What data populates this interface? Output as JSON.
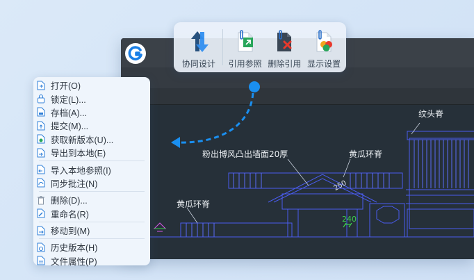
{
  "toolbar": {
    "items": [
      {
        "label": "协同设计",
        "icon": "collaborate-icon"
      },
      {
        "label": "引用参照",
        "icon": "reference-attach-icon"
      },
      {
        "label": "删除引用",
        "icon": "reference-delete-icon"
      },
      {
        "label": "显示设置",
        "icon": "display-settings-icon"
      }
    ]
  },
  "menu": {
    "groups": [
      [
        {
          "label": "打开(O)",
          "icon": "open-file-icon"
        },
        {
          "label": "锁定(L)...",
          "icon": "lock-icon"
        },
        {
          "label": "存档(A)...",
          "icon": "archive-file-icon"
        },
        {
          "label": "提交(M)...",
          "icon": "submit-file-icon"
        },
        {
          "label": "获取新版本(U)...",
          "icon": "get-latest-icon"
        },
        {
          "label": "导出到本地(E)",
          "icon": "export-file-icon"
        }
      ],
      [
        {
          "label": "导入本地参照(I)",
          "icon": "import-reference-icon"
        },
        {
          "label": "同步批注(N)",
          "icon": "sync-annotation-icon"
        }
      ],
      [
        {
          "label": "删除(D)...",
          "icon": "trash-icon"
        },
        {
          "label": "重命名(R)",
          "icon": "rename-file-icon"
        }
      ],
      [
        {
          "label": "移动到(M)",
          "icon": "move-file-icon"
        }
      ],
      [
        {
          "label": "历史版本(H)",
          "icon": "history-file-icon"
        },
        {
          "label": "文件属性(P)",
          "icon": "file-properties-icon"
        }
      ]
    ]
  },
  "drawing": {
    "labels": {
      "top_right": "纹头脊",
      "middle": "粉出博风凸出墙面20厚",
      "middle_right": "黄瓜环脊",
      "left": "黄瓜环脊",
      "dim_250": "250",
      "dim_240": "240"
    }
  },
  "colors": {
    "accent": "#1a8ff0",
    "cad_line": "#4a5cf0",
    "cad_text": "#e8ecf0",
    "cad_dim": "#3ccf4e"
  }
}
